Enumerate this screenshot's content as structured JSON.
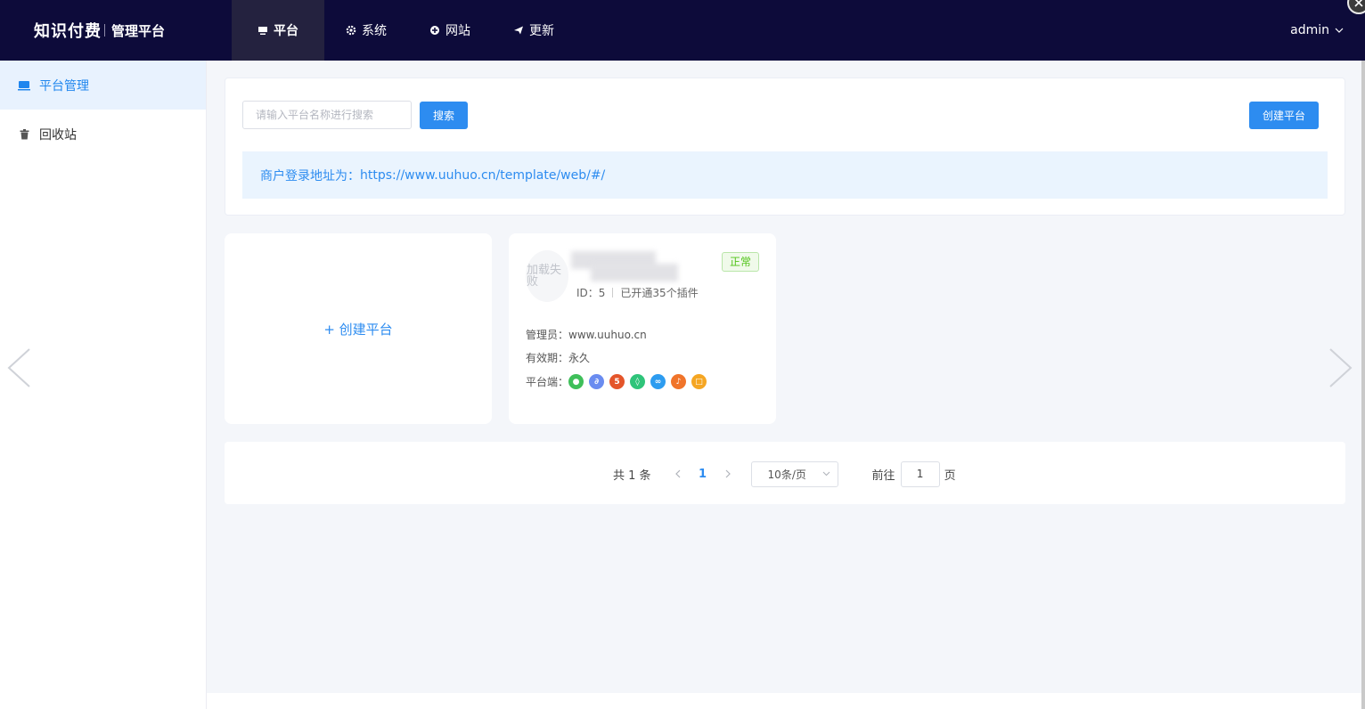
{
  "header": {
    "brand_main": "知识付费",
    "brand_sub": "管理平台",
    "nav": [
      {
        "label": "平台",
        "icon": "monitor-icon",
        "active": true
      },
      {
        "label": "系统",
        "icon": "gear-icon",
        "active": false
      },
      {
        "label": "网站",
        "icon": "plus-circle-icon",
        "active": false
      },
      {
        "label": "更新",
        "icon": "send-icon",
        "active": false
      }
    ],
    "user": "admin"
  },
  "sidebar": {
    "items": [
      {
        "label": "平台管理",
        "icon": "laptop-icon",
        "active": true
      },
      {
        "label": "回收站",
        "icon": "trash-icon",
        "active": false
      }
    ]
  },
  "search": {
    "placeholder": "请输入平台名称进行搜索",
    "button": "搜索",
    "create_button": "创建平台"
  },
  "login_bar": {
    "label": "商户登录地址为：",
    "url": "https://www.uuhuo.cn/template/web/#/"
  },
  "cards": {
    "create_label": "+ 创建平台",
    "platform": {
      "avatar_text": "加载失败",
      "status": "正常",
      "id_label": "ID：5",
      "plugins": "已开通35个插件",
      "admin_label": "管理员：",
      "admin_value": "www.uuhuo.cn",
      "expiry_label": "有效期：",
      "expiry_value": "永久",
      "platforms_label": "平台端：",
      "platform_icons": [
        {
          "name": "wechat-icon",
          "color": "#3fbf5a",
          "glyph": "●"
        },
        {
          "name": "miniprogram-icon",
          "color": "#6a8cf0",
          "glyph": "∂"
        },
        {
          "name": "html5-icon",
          "color": "#e4552a",
          "glyph": "5"
        },
        {
          "name": "app-icon",
          "color": "#2fc47a",
          "glyph": "◊"
        },
        {
          "name": "link-icon",
          "color": "#2d9cf0",
          "glyph": "∞"
        },
        {
          "name": "douyin-icon",
          "color": "#f0742a",
          "glyph": "♪"
        },
        {
          "name": "pc-icon",
          "color": "#f5a623",
          "glyph": "□"
        }
      ]
    }
  },
  "pagination": {
    "total": "共 1 条",
    "current": "1",
    "page_size": "10条/页",
    "goto_label": "前往",
    "goto_value": "1",
    "page_suffix": "页"
  }
}
